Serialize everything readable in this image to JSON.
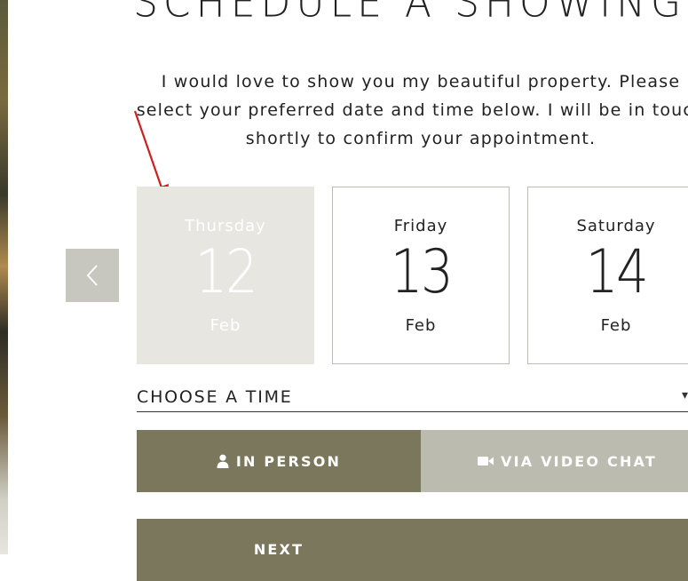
{
  "title": "SCHEDULE A SHOWING",
  "intro": "I would love to show you my beautiful property. Please select your preferred date and time below. I will be in touch shortly to confirm your appointment.",
  "colors": {
    "selected_card_bg": "#e8e6e1",
    "primary_button": "#7b775d",
    "secondary_button": "#bcbbb0",
    "prev_button": "#c7c7bf",
    "arrow": "#cc1f1f"
  },
  "dates": [
    {
      "day": "Thursday",
      "num": "12",
      "month": "Feb",
      "selected": true
    },
    {
      "day": "Friday",
      "num": "13",
      "month": "Feb",
      "selected": false
    },
    {
      "day": "Saturday",
      "num": "14",
      "month": "Feb",
      "selected": false
    }
  ],
  "time_select": {
    "label": "CHOOSE A TIME",
    "icon": "chevron-down-icon"
  },
  "modes": {
    "in_person": {
      "label": "IN PERSON",
      "icon": "user-icon"
    },
    "video": {
      "label": "VIA VIDEO CHAT",
      "icon": "video-camera-icon"
    }
  },
  "next_label": "NEXT",
  "prev_icon": "chevron-left-icon",
  "annotation_icon": "red-arrow-icon"
}
